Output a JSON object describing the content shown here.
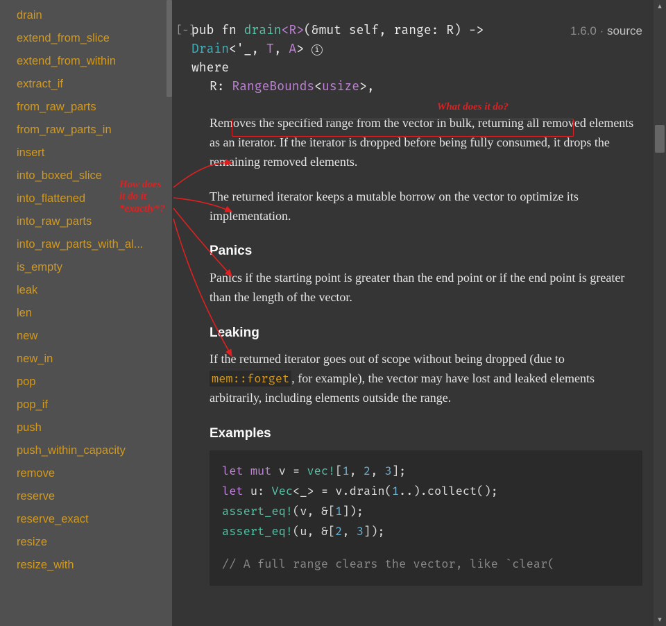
{
  "sidebar": {
    "items": [
      "drain",
      "extend_from_slice",
      "extend_from_within",
      "extract_if",
      "from_raw_parts",
      "from_raw_parts_in",
      "insert",
      "into_boxed_slice",
      "into_flattened",
      "into_raw_parts",
      "into_raw_parts_with_al...",
      "is_empty",
      "leak",
      "len",
      "new",
      "new_in",
      "pop",
      "pop_if",
      "push",
      "push_within_capacity",
      "remove",
      "reserve",
      "reserve_exact",
      "resize",
      "resize_with"
    ]
  },
  "header": {
    "collapse": "[−]",
    "pub_fn": "pub fn ",
    "name": "drain",
    "generics": "<R>",
    "sig_after_generics": "(&mut self, range: R) ->",
    "ret_type": "Drain",
    "ret_gen_open": "<'_, ",
    "ret_ty_t": "T",
    "ret_comma": ", ",
    "ret_ty_a": "A",
    "ret_gen_close": "> ",
    "info": "ⓘ",
    "where_kw": "where",
    "where_r": "R: ",
    "where_trait": "RangeBounds",
    "where_gen_open": "<",
    "where_usize": "usize",
    "where_gen_close": ">,",
    "since": "1.6.0",
    "dot": " · ",
    "source": "source"
  },
  "doc": {
    "p1_pre": "Removes the specified range from the vector in bulk,",
    "p1_post": " returning all removed elements as an iterator. If the iterator is dropped before being fully consumed, it drops the remaining removed elements.",
    "p2": "The returned iterator keeps a mutable borrow on the vector to optimize its implementation.",
    "h_panics": "Panics",
    "p_panics": "Panics if the starting point is greater than the end point or if the end point is greater than the length of the vector.",
    "h_leaking": "Leaking",
    "p_leak_pre": "If the returned iterator goes out of scope without being dropped (due to ",
    "p_leak_code": "mem::forget",
    "p_leak_post": ", for example), the vector may have lost and leaked elements arbitrarily, including elements outside the range.",
    "h_examples": "Examples"
  },
  "code": {
    "l1a": "let ",
    "l1b": "mut",
    "l1c": " v = ",
    "l1d": "vec!",
    "l1e": "[",
    "l1n1": "1",
    "l1s": ", ",
    "l1n2": "2",
    "l1n3": "3",
    "l1f": "];",
    "l2a": "let ",
    "l2b": "u: ",
    "l2c": "Vec",
    "l2d": "<_> = v.drain(",
    "l2n": "1",
    "l2e": "..).collect();",
    "l3a": "assert_eq!",
    "l3b": "(v, &[",
    "l3n": "1",
    "l3c": "]);",
    "l4a": "assert_eq!",
    "l4b": "(u, &[",
    "l4n1": "2",
    "l4s": ", ",
    "l4n2": "3",
    "l4c": "]);",
    "l5": "// A full range clears the vector, like `clear("
  },
  "annotations": {
    "what": "What does it do?",
    "how": "How does\nit do it\n*exactly*?"
  }
}
